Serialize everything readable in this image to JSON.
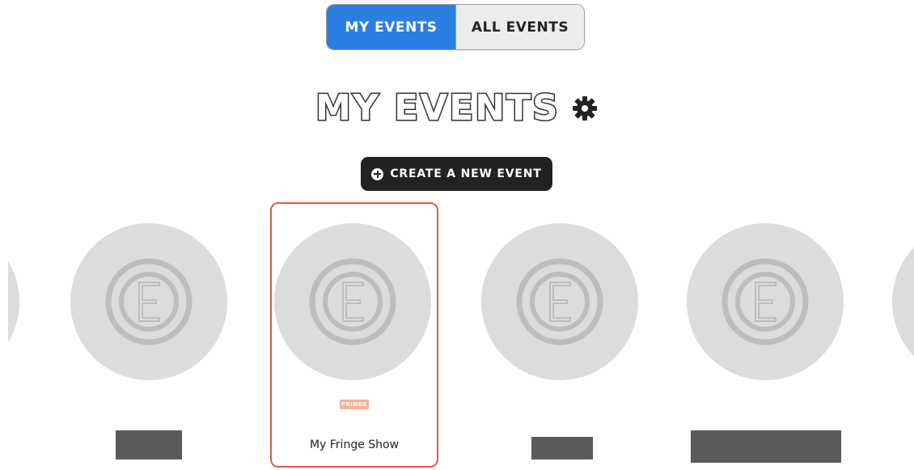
{
  "tabs": [
    {
      "label": "MY EVENTS",
      "active": true
    },
    {
      "label": "ALL EVENTS",
      "active": false
    }
  ],
  "heading": {
    "title": "MY EVENTS",
    "settings_icon": "gear-icon"
  },
  "create_button": {
    "label": "CREATE A NEW EVENT",
    "icon": "plus-circle-icon"
  },
  "events": [
    {
      "name": "",
      "redacted": true
    },
    {
      "name": "My Fringe Show",
      "logo_text": "FRINGE",
      "selected": true
    },
    {
      "name": "",
      "redacted": true
    },
    {
      "name": "",
      "redacted": true
    }
  ],
  "colors": {
    "accent": "#2a7fe0",
    "selected_border": "#e05a45",
    "button_bg": "#222222",
    "placeholder": "#dcdcdc"
  }
}
